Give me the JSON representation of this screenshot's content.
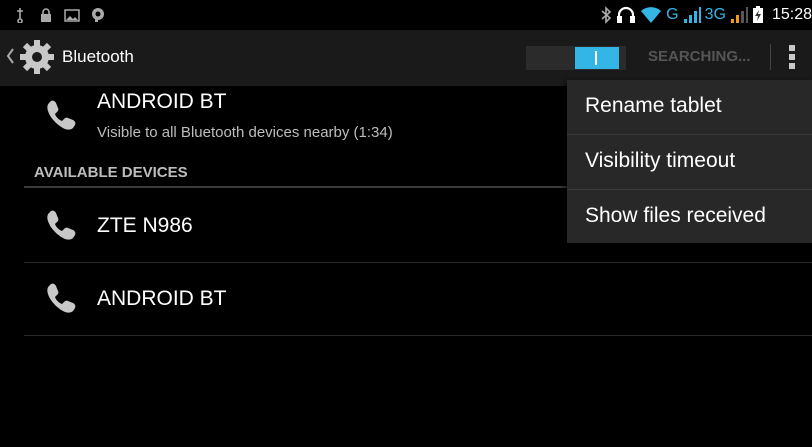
{
  "status_bar": {
    "time": "15:28",
    "network_g": "G",
    "network_3g": "3G",
    "left_icons": [
      "usb-icon",
      "lock-icon",
      "image-icon",
      "chat-icon"
    ],
    "right_icons": [
      "bluetooth-icon",
      "headset-icon",
      "wifi-icon",
      "signal-icon",
      "signal-icon",
      "battery-icon"
    ]
  },
  "action_bar": {
    "title": "Bluetooth",
    "status": "SEARCHING...",
    "switch_on": true
  },
  "this_device": {
    "name": "ANDROID BT",
    "visibility": "Visible to all Bluetooth devices nearby (1:34)"
  },
  "available_devices": {
    "title": "AVAILABLE DEVICES",
    "items": [
      {
        "name": "ZTE N986"
      },
      {
        "name": "ANDROID BT"
      }
    ]
  },
  "overflow_menu": {
    "items": [
      "Rename tablet",
      "Visibility timeout",
      "Show files received"
    ]
  },
  "colors": {
    "accent": "#33b5e5",
    "icon_gray": "#c8c8c8"
  }
}
